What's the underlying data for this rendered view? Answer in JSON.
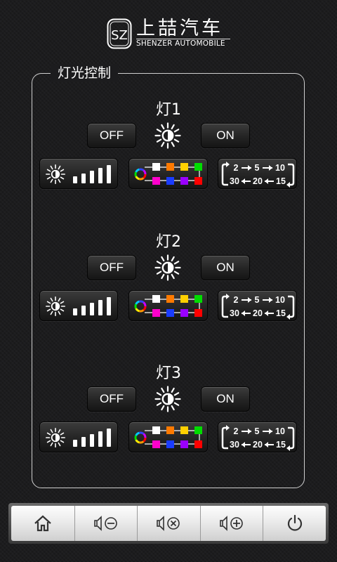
{
  "header": {
    "logo_mark": "SZ",
    "brand_cn": "上喆汽车",
    "brand_en": "SHENZER AUTOMOBILE"
  },
  "panel": {
    "title": "灯光控制"
  },
  "lights": [
    {
      "title": "灯1",
      "off_label": "OFF",
      "on_label": "ON"
    },
    {
      "title": "灯2",
      "off_label": "OFF",
      "on_label": "ON"
    },
    {
      "title": "灯3",
      "off_label": "OFF",
      "on_label": "ON"
    }
  ],
  "cycle_labels": {
    "top": [
      "2",
      "5",
      "10"
    ],
    "bottom": [
      "30",
      "20",
      "15"
    ]
  },
  "color_swatches": {
    "top": [
      "#ffffff",
      "#ff7a00",
      "#ffd000",
      "#00dd00"
    ],
    "bottom": [
      "#ff00cc",
      "#1a3cff",
      "#9a00ff",
      "#ff0000"
    ]
  },
  "icons": {
    "sun": "sun-icon",
    "brightness": "brightness-bars-icon",
    "color": "color-palette-icon",
    "cycle": "cycle-timer-icon"
  },
  "bottom_bar": [
    {
      "name": "home",
      "icon": "home-icon"
    },
    {
      "name": "volume-down",
      "icon": "volume-minus-icon"
    },
    {
      "name": "mute",
      "icon": "volume-mute-icon"
    },
    {
      "name": "volume-up",
      "icon": "volume-plus-icon"
    },
    {
      "name": "power",
      "icon": "power-icon"
    }
  ]
}
